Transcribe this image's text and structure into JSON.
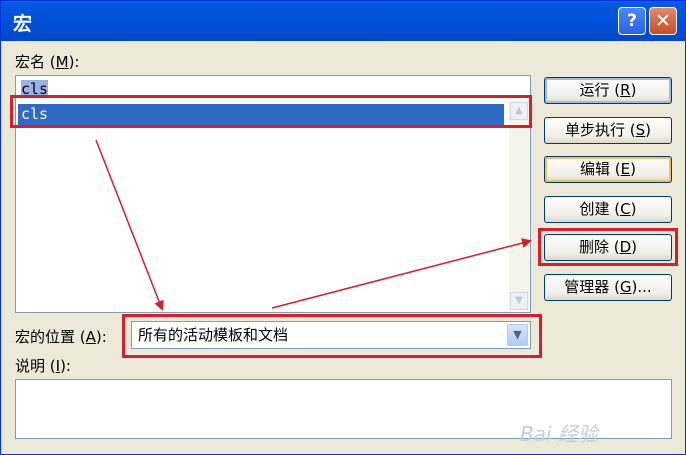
{
  "window": {
    "title": "宏",
    "help_button": "?",
    "close_button": "✕"
  },
  "macro_name": {
    "label_pre": "宏名 (",
    "label_key": "M",
    "label_post": "):",
    "input_value": "cls",
    "list_items": [
      "cls"
    ]
  },
  "buttons": [
    {
      "pre": "运行 (",
      "key": "R",
      "post": ")"
    },
    {
      "pre": "单步执行 (",
      "key": "S",
      "post": ")"
    },
    {
      "pre": "编辑 (",
      "key": "E",
      "post": ")"
    },
    {
      "pre": "创建 (",
      "key": "C",
      "post": ")"
    },
    {
      "pre": "删除 (",
      "key": "D",
      "post": ")"
    },
    {
      "pre": "管理器 (",
      "key": "G",
      "post": ")..."
    }
  ],
  "location": {
    "label_pre": "宏的位置 (",
    "label_key": "A",
    "label_post": "):",
    "selected": "所有的活动模板和文档"
  },
  "description": {
    "label_pre": "说明 (",
    "label_key": "I",
    "label_post": "):",
    "value": ""
  },
  "watermark": "Bai 经验",
  "colors": {
    "titlebar": "#0050d8",
    "selection": "#316ac5",
    "annotation": "#d2202e",
    "dialog_face": "#ece9d8"
  },
  "icons": {
    "help": "question-icon",
    "close": "close-icon",
    "dropdown": "chevron-down-icon"
  }
}
